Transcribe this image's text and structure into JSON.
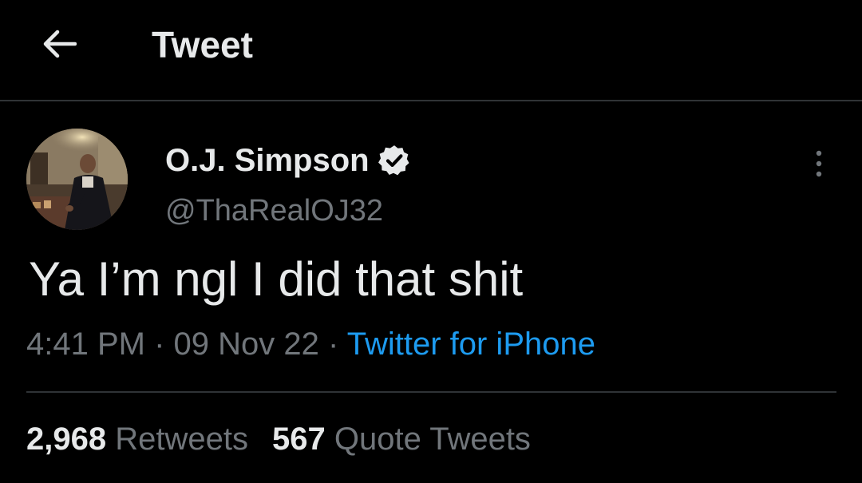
{
  "header": {
    "title": "Tweet",
    "back_icon": "arrow-left-icon"
  },
  "tweet": {
    "author": {
      "name": "O.J. Simpson",
      "handle": "@ThaRealOJ32",
      "verified": true,
      "verified_icon": "verified-badge-icon"
    },
    "more_icon": "more-vertical-icon",
    "text": "Ya I’m ngl I did that shit",
    "time": "4:41 PM",
    "date": "09 Nov 22",
    "separator": "·",
    "source": "Twitter for iPhone",
    "stats": {
      "retweets_count": "2,968",
      "retweets_label": "Retweets",
      "quotes_count": "567",
      "quotes_label": "Quote Tweets"
    }
  },
  "colors": {
    "background": "#000000",
    "text_primary": "#e7e9ea",
    "text_secondary": "#71767b",
    "link": "#1d9bf0",
    "divider": "#2f3336"
  }
}
